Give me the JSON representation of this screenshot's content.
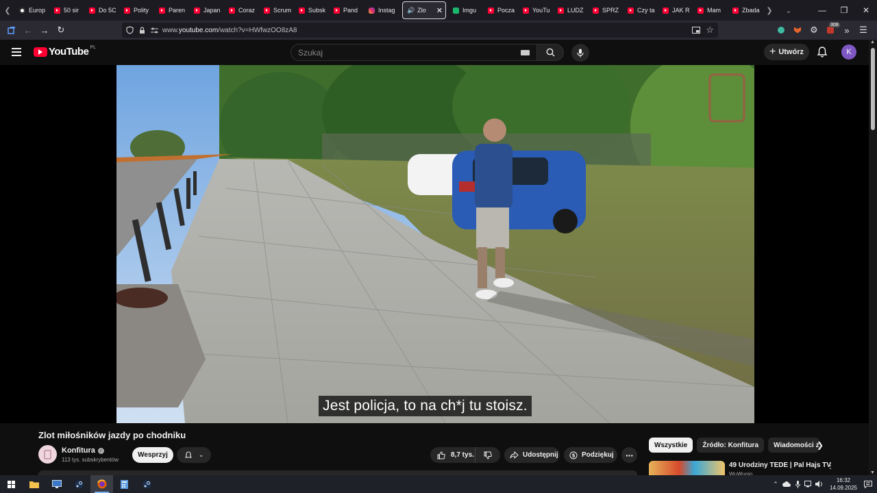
{
  "browser": {
    "tabs": [
      {
        "label": "Europ",
        "icon": "globe-icon"
      },
      {
        "label": "50 sir",
        "icon": "youtube-icon"
      },
      {
        "label": "Do 5C",
        "icon": "youtube-icon"
      },
      {
        "label": "Polity",
        "icon": "youtube-icon"
      },
      {
        "label": "Paren",
        "icon": "youtube-icon"
      },
      {
        "label": "Japan",
        "icon": "youtube-icon"
      },
      {
        "label": "Coraz",
        "icon": "youtube-icon"
      },
      {
        "label": "Scrum",
        "icon": "youtube-icon"
      },
      {
        "label": "Subsk",
        "icon": "youtube-icon"
      },
      {
        "label": "Pand",
        "icon": "youtube-icon"
      },
      {
        "label": "Instag",
        "icon": "instagram-icon"
      },
      {
        "label": "Zlo",
        "icon": "speaker-icon",
        "active": true
      },
      {
        "label": "Imgu",
        "icon": "imgur-icon"
      },
      {
        "label": "Pocza",
        "icon": "youtube-icon"
      },
      {
        "label": "YouTu",
        "icon": "youtube-icon"
      },
      {
        "label": "LUDZ",
        "icon": "youtube-icon"
      },
      {
        "label": "SPRZ",
        "icon": "youtube-icon"
      },
      {
        "label": "Czy ta",
        "icon": "youtube-icon"
      },
      {
        "label": "JAK R",
        "icon": "youtube-icon"
      },
      {
        "label": "Mam",
        "icon": "youtube-icon"
      },
      {
        "label": "Zbada",
        "icon": "youtube-icon"
      }
    ],
    "url_prefix": "www.",
    "url_host": "youtube.com",
    "url_path": "/watch?v=HWfwzOO8zA8",
    "extension_badge": "308"
  },
  "youtube": {
    "logo_text": "YouTube",
    "country_code": "PL",
    "search_placeholder": "Szukaj",
    "create_label": "Utwórz",
    "avatar_letter": "K"
  },
  "video": {
    "caption": "Jest policja, to na ch*j tu stoisz.",
    "title": "Zlot miłośników jazdy po chodniku",
    "channel_name": "Konfitura",
    "channel_subs": "113 tys. subskrybentów",
    "support_label": "Wesprzyj",
    "likes": "8,7 tys.",
    "share_label": "Udostępnij",
    "thanks_label": "Podziękuj"
  },
  "sidebar": {
    "chips": [
      "Wszystkie",
      "Źródło: Konfitura",
      "Wiadomości ze"
    ],
    "recommended": {
      "title": "49 Urodziny TEDE | Pal Hajs TV",
      "channel": "WuWunio"
    }
  },
  "taskbar": {
    "time": "16:32",
    "date": "14.09.2025"
  },
  "colors": {
    "yt_red": "#ff0033",
    "background": "#0f0f0f",
    "avatar": "#7e57c2"
  }
}
